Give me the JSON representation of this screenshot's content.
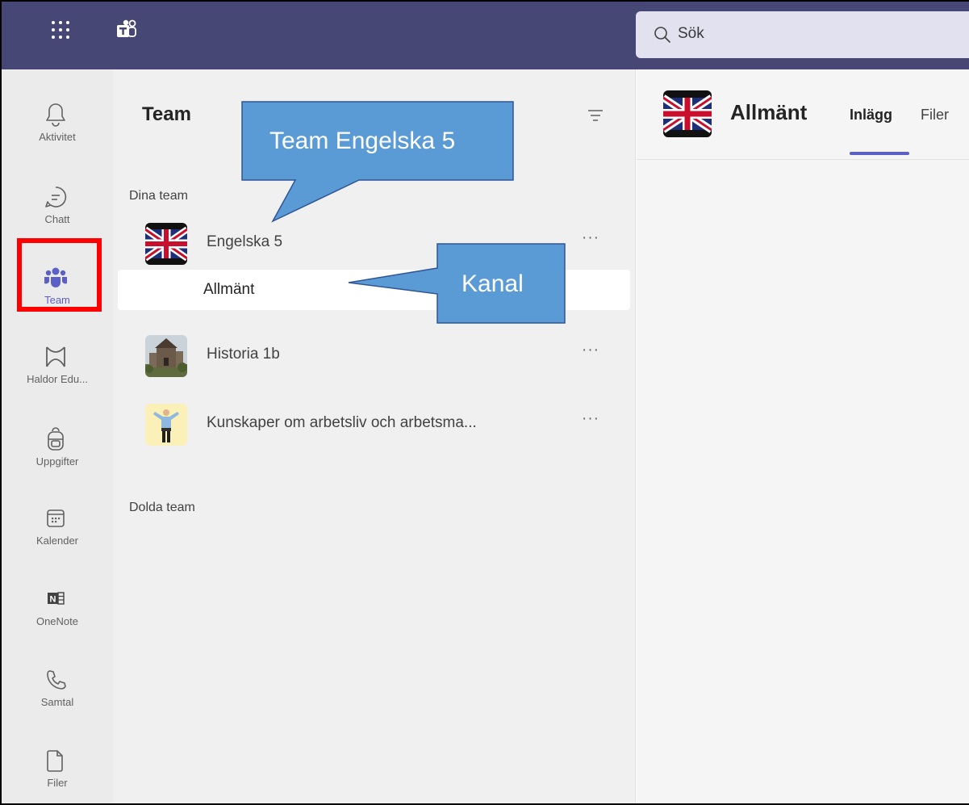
{
  "topbar": {
    "search_placeholder": "Sök"
  },
  "rail": {
    "items": [
      {
        "label": "Aktivitet",
        "icon": "bell-icon"
      },
      {
        "label": "Chatt",
        "icon": "chat-icon"
      },
      {
        "label": "Team",
        "icon": "teams-icon",
        "active": true
      },
      {
        "label": "Haldor Edu...",
        "icon": "haldor-icon"
      },
      {
        "label": "Uppgifter",
        "icon": "backpack-icon"
      },
      {
        "label": "Kalender",
        "icon": "calendar-icon"
      },
      {
        "label": "OneNote",
        "icon": "onenote-icon"
      },
      {
        "label": "Samtal",
        "icon": "phone-icon"
      },
      {
        "label": "Filer",
        "icon": "file-icon"
      }
    ]
  },
  "teams_pane": {
    "title": "Team",
    "your_teams_label": "Dina team",
    "hidden_teams_label": "Dolda team",
    "teams": [
      {
        "name": "Engelska 5",
        "more": "···"
      },
      {
        "name": "Historia 1b",
        "more": "···"
      },
      {
        "name": "Kunskaper om arbetsliv och arbetsma...",
        "more": "···"
      }
    ],
    "channel": "Allmänt"
  },
  "main": {
    "channel_title": "Allmänt",
    "tabs": [
      {
        "label": "Inlägg",
        "active": true
      },
      {
        "label": "Filer",
        "active": false
      }
    ]
  },
  "annotations": {
    "team_callout": "Team Engelska 5",
    "channel_callout": "Kanal"
  },
  "colors": {
    "topbar": "#464775",
    "accent": "#5b5fc7",
    "callout_fill": "#5b9bd5",
    "highlight": "#ff0000"
  }
}
